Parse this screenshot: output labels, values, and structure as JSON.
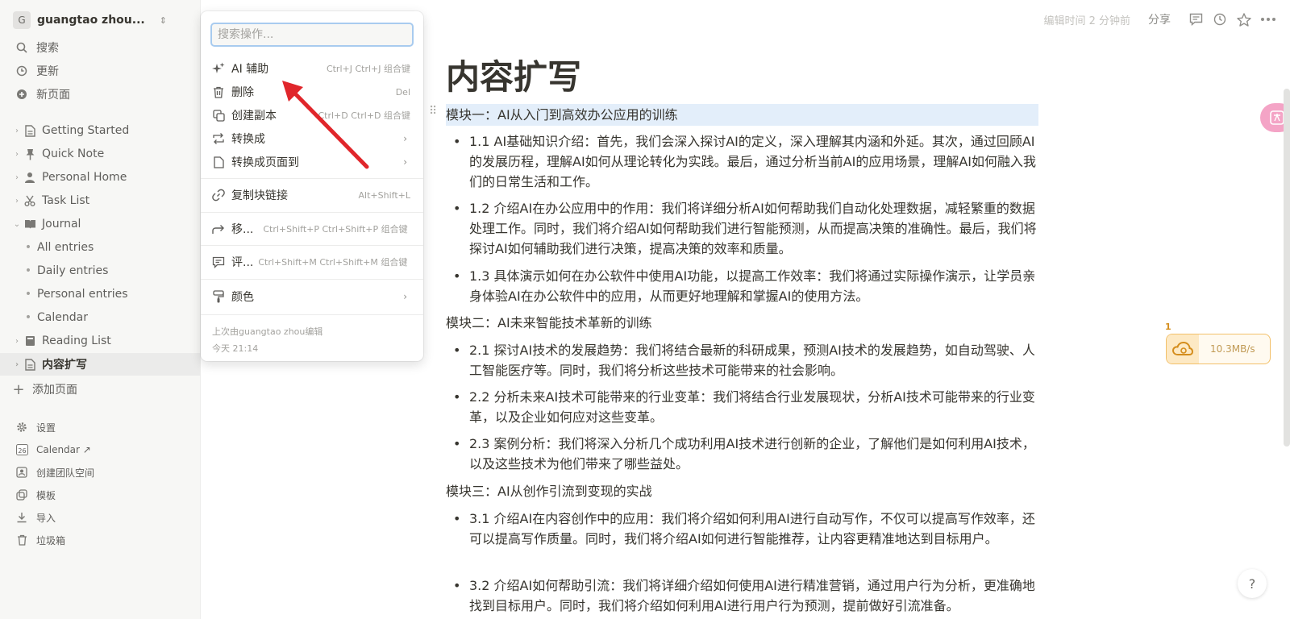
{
  "workspace": {
    "initial": "G",
    "name": "guangtao zhou..."
  },
  "sidebar": {
    "top": [
      {
        "label": "搜索",
        "icon": "search-icon"
      },
      {
        "label": "更新",
        "icon": "clock-icon"
      },
      {
        "label": "新页面",
        "icon": "plus-circle-icon"
      }
    ],
    "pages": [
      {
        "label": "Getting Started",
        "icon": "page-icon"
      },
      {
        "label": "Quick Note",
        "icon": "pin-icon"
      },
      {
        "label": "Personal Home",
        "icon": "person-icon"
      },
      {
        "label": "Task List",
        "icon": "scissors-icon"
      },
      {
        "label": "Journal",
        "icon": "book-icon"
      },
      {
        "label": "All entries"
      },
      {
        "label": "Daily entries"
      },
      {
        "label": "Personal entries"
      },
      {
        "label": "Calendar"
      },
      {
        "label": "Reading List",
        "icon": "book-icon"
      },
      {
        "label": "内容扩写",
        "icon": "page-icon"
      }
    ],
    "add_page": "添加页面",
    "bottom": [
      {
        "label": "设置",
        "icon": "gear-icon"
      },
      {
        "label": "Calendar ↗",
        "icon": "calendar-icon",
        "badge": "26"
      },
      {
        "label": "创建团队空间",
        "icon": "team-icon"
      },
      {
        "label": "模板",
        "icon": "template-icon"
      },
      {
        "label": "导入",
        "icon": "import-icon"
      },
      {
        "label": "垃圾箱",
        "icon": "trash-icon"
      }
    ]
  },
  "topbar": {
    "edited": "编辑时间 2 分钟前",
    "share": "分享"
  },
  "doc": {
    "title": "内容扩写",
    "blocks": [
      "模块一：AI从入门到高效办公应用的训练",
      "1.1 AI基础知识介绍：首先，我们会深入探讨AI的定义，深入理解其内涵和外延。其次，通过回顾AI的发展历程，理解AI如何从理论转化为实践。最后，通过分析当前AI的应用场景，理解AI如何融入我们的日常生活和工作。",
      "1.2 介绍AI在办公应用中的作用：我们将详细分析AI如何帮助我们自动化处理数据，减轻繁重的数据处理工作。同时，我们将介绍AI如何帮助我们进行智能预测，从而提高决策的准确性。最后，我们将探讨AI如何辅助我们进行决策，提高决策的效率和质量。",
      "1.3 具体演示如何在办公软件中使用AI功能，以提高工作效率：我们将通过实际操作演示，让学员亲身体验AI在办公软件中的应用，从而更好地理解和掌握AI的使用方法。",
      "模块二：AI未来智能技术革新的训练",
      "2.1 探讨AI技术的发展趋势：我们将结合最新的科研成果，预测AI技术的发展趋势，如自动驾驶、人工智能医疗等。同时，我们将分析这些技术可能带来的社会影响。",
      "2.2 分析未来AI技术可能带来的行业变革：我们将结合行业发展现状，分析AI技术可能带来的行业变革，以及企业如何应对这些变革。",
      "2.3 案例分析：我们将深入分析几个成功利用AI技术进行创新的企业，了解他们是如何利用AI技术，以及这些技术为他们带来了哪些益处。",
      "模块三：AI从创作引流到变现的实战",
      "3.1 介绍AI在内容创作中的应用：我们将介绍如何利用AI进行自动写作，不仅可以提高写作效率，还可以提高写作质量。同时，我们将介绍AI如何进行智能推荐，让内容更精准地达到目标用户。",
      "3.2 介绍AI如何帮助引流：我们将详细介绍如何使用AI进行精准营销，通过用户行为分析，更准确地找到目标用户。同时，我们将介绍如何利用AI进行用户行为预测，提前做好引流准备。"
    ]
  },
  "menu": {
    "search_placeholder": "搜索操作...",
    "items": [
      {
        "label": "AI 辅助",
        "shortcut": "Ctrl+J Ctrl+J 组合键",
        "icon": "sparkle-icon"
      },
      {
        "label": "删除",
        "shortcut": "Del",
        "icon": "trash-icon"
      },
      {
        "label": "创建副本",
        "shortcut": "Ctrl+D Ctrl+D 组合键",
        "icon": "duplicate-icon"
      },
      {
        "label": "转换成",
        "icon": "convert-icon"
      },
      {
        "label": "转换成页面到",
        "icon": "page-icon"
      },
      {
        "label": "复制块链接",
        "shortcut": "Alt+Shift+L",
        "icon": "link-icon"
      },
      {
        "label": "移...",
        "shortcut": "Ctrl+Shift+P Ctrl+Shift+P 组合键",
        "icon": "move-icon"
      },
      {
        "label": "评...",
        "shortcut": "Ctrl+Shift+M Ctrl+Shift+M 组合键",
        "icon": "comment-icon"
      },
      {
        "label": "颜色",
        "icon": "paint-icon"
      }
    ],
    "footer_editor": "上次由guangtao zhou编辑",
    "footer_time": "今天 21:14"
  },
  "widgets": {
    "speed": "10.3MB/s",
    "speed_badge": "1",
    "help": "?"
  },
  "colors": {
    "highlight": "#e3eefa",
    "arrow": "#e0262b",
    "accent": "#2383e2"
  }
}
